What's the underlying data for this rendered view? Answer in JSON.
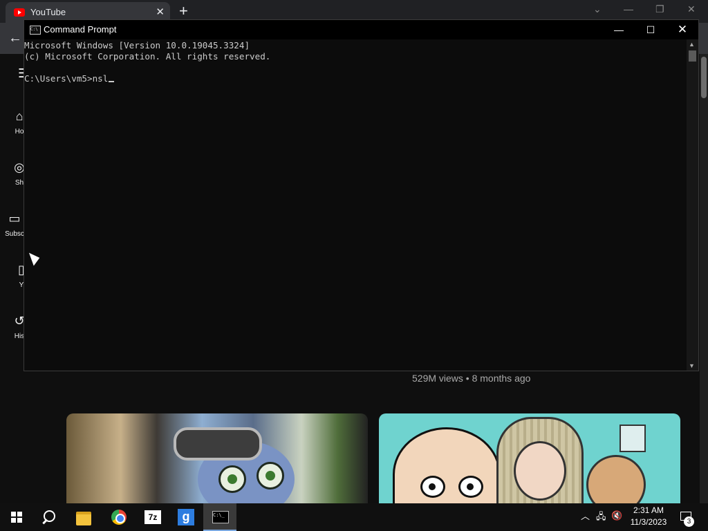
{
  "browser": {
    "tab_title": "YouTube",
    "tab_close": "✕",
    "new_tab": "+",
    "back": "←"
  },
  "youtube": {
    "sidebar": [
      {
        "label": "Ho",
        "icon": "home-icon"
      },
      {
        "label": "Sh",
        "icon": "shorts-icon"
      },
      {
        "label": "Subsc",
        "icon": "subscriptions-icon"
      },
      {
        "label": "Y",
        "icon": "library-icon"
      },
      {
        "label": "His",
        "icon": "history-icon"
      }
    ],
    "video_meta": "529M views • 8 months ago"
  },
  "cmd": {
    "title": "Command Prompt",
    "lines": [
      "Microsoft Windows [Version 10.0.19045.3324]",
      "(c) Microsoft Corporation. All rights reserved.",
      "",
      "C:\\Users\\vm5>nsl"
    ],
    "controls": {
      "minimize": "—",
      "maximize": "☐",
      "close": "✕"
    }
  },
  "taskbar": {
    "apps": [
      "start-icon",
      "search-icon",
      "file-explorer-icon",
      "chrome-icon",
      "7zip-icon",
      "g-app-icon",
      "command-prompt-icon"
    ],
    "zip_label": "7z",
    "g_label": "g",
    "cmd_mini": "C:\\_",
    "time": "2:31 AM",
    "date": "11/3/2023",
    "notification_count": "3"
  },
  "colors": {
    "cmd_text": "#cccccc",
    "cmd_bg": "#0c0c0c",
    "youtube_red": "#ff0000",
    "taskbar_bg": "#101010"
  }
}
